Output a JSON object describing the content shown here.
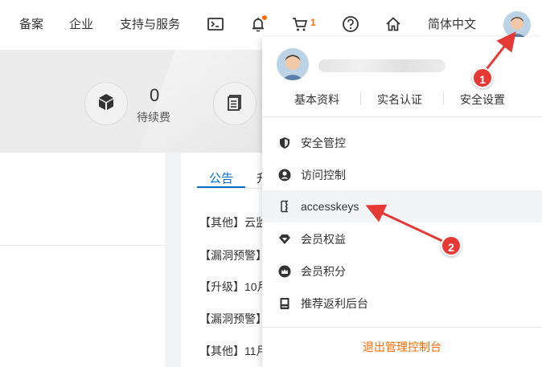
{
  "nav": {
    "filing": "备案",
    "enterprise": "企业",
    "support": "支持与服务",
    "cart_count": "1",
    "language": "简体中文",
    "icons": [
      "terminal-icon",
      "bell-icon",
      "cart-icon",
      "help-icon",
      "home-icon"
    ]
  },
  "banner": {
    "stat_value": "0",
    "stat_label": "待续费"
  },
  "notices": {
    "tab_active": "公告",
    "tab_second": "升",
    "items": [
      "【其他】云监",
      "【漏洞预警】",
      "【升级】10月",
      "【漏洞预警】",
      "【其他】11月"
    ]
  },
  "dropdown": {
    "links": [
      "基本资料",
      "实名认证",
      "安全设置"
    ],
    "menu": [
      {
        "label": "安全管控",
        "icon": "shield-icon"
      },
      {
        "label": "访问控制",
        "icon": "user-icon"
      },
      {
        "label": "accesskeys",
        "icon": "key-icon"
      },
      {
        "label": "会员权益",
        "icon": "diamond-icon"
      },
      {
        "label": "会员积分",
        "icon": "crown-icon"
      },
      {
        "label": "推荐返利后台",
        "icon": "document-icon"
      }
    ],
    "logout": "退出管理控制台"
  },
  "annotations": {
    "marker1": "1",
    "marker2": "2",
    "color": "#e53935"
  },
  "colors": {
    "accent": "#ff6a00",
    "link_blue": "#0070cc"
  }
}
